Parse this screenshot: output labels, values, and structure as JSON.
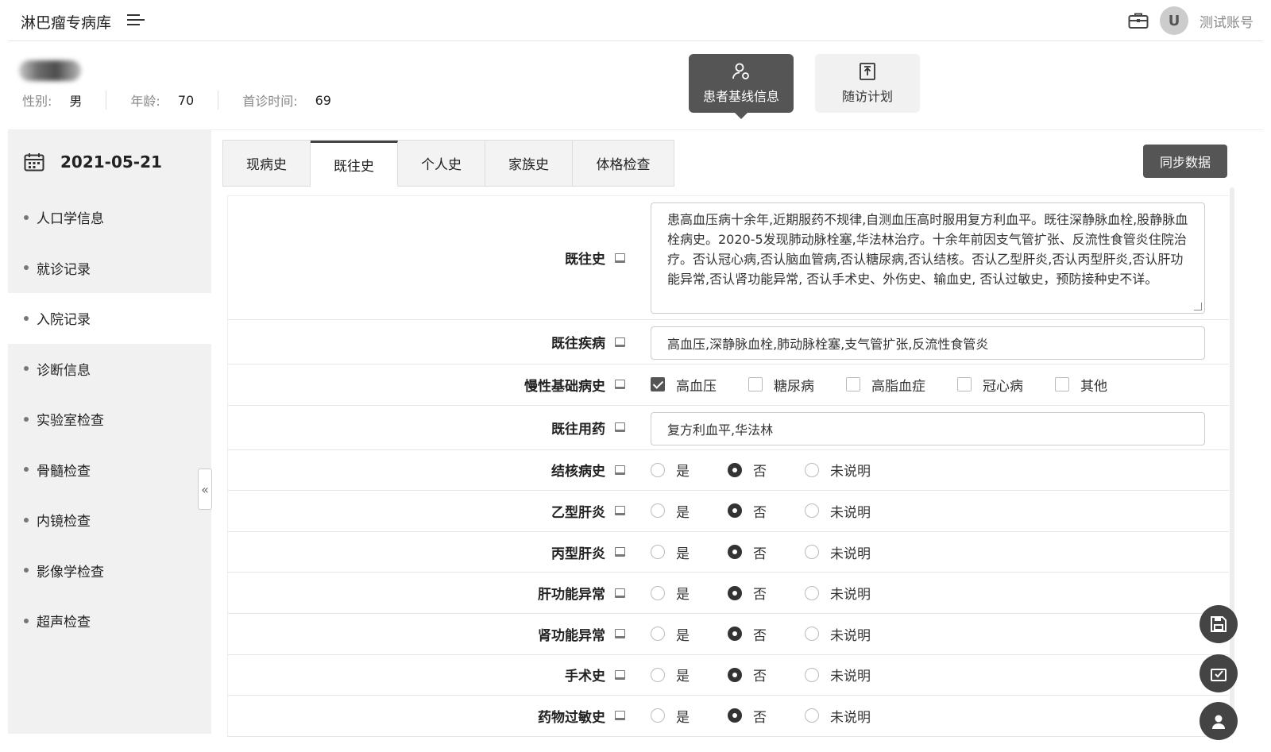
{
  "app": {
    "title": "淋巴瘤专病库",
    "account_avatar_letter": "U",
    "account_name": "测试账号"
  },
  "patient": {
    "gender_label": "性别:",
    "gender_value": "男",
    "age_label": "年龄:",
    "age_value": "70",
    "first_visit_label": "首诊时间:",
    "first_visit_value": "69"
  },
  "nav": {
    "baseline": "患者基线信息",
    "followup": "随访计划"
  },
  "sidebar": {
    "date": "2021-05-21",
    "items": [
      {
        "label": "人口学信息"
      },
      {
        "label": "就诊记录"
      },
      {
        "label": "入院记录"
      },
      {
        "label": "诊断信息"
      },
      {
        "label": "实验室检查"
      },
      {
        "label": "骨髓检查"
      },
      {
        "label": "内镜检查"
      },
      {
        "label": "影像学检查"
      },
      {
        "label": "超声检查"
      }
    ],
    "active_index": 2
  },
  "tabs": [
    {
      "label": "现病史"
    },
    {
      "label": "既往史"
    },
    {
      "label": "个人史"
    },
    {
      "label": "家族史"
    },
    {
      "label": "体格检查"
    }
  ],
  "sync_label": "同步数据",
  "form": {
    "past_history": {
      "label": "既往史",
      "value": "患高血压病十余年,近期服药不规律,自测血压高时服用复方利血平。既往深静脉血栓,股静脉血栓病史。2020-5发现肺动脉栓塞,华法林治疗。十余年前因支气管扩张、反流性食管炎住院治疗。否认冠心病,否认脑血管病,否认糖尿病,否认结核。否认乙型肝炎,否认丙型肝炎,否认肝功能异常,否认肾功能异常, 否认手术史、外伤史、输血史, 否认过敏史，预防接种史不详。"
    },
    "past_disease": {
      "label": "既往疾病",
      "value": "高血压,深静脉血栓,肺动脉栓塞,支气管扩张,反流性食管炎"
    },
    "chronic": {
      "label": "慢性基础病史",
      "options": [
        "高血压",
        "糖尿病",
        "高脂血症",
        "冠心病",
        "其他"
      ],
      "checked": [
        true,
        false,
        false,
        false,
        false
      ]
    },
    "past_meds": {
      "label": "既往用药",
      "value": "复方利血平,华法林"
    },
    "radio_options": [
      "是",
      "否",
      "未说明"
    ],
    "radio_rows": [
      {
        "label": "结核病史",
        "selected": 1
      },
      {
        "label": "乙型肝炎",
        "selected": 1
      },
      {
        "label": "丙型肝炎",
        "selected": 1
      },
      {
        "label": "肝功能异常",
        "selected": 1
      },
      {
        "label": "肾功能异常",
        "selected": 1
      },
      {
        "label": "手术史",
        "selected": 1
      },
      {
        "label": "药物过敏史",
        "selected": 1
      }
    ]
  },
  "colors": {
    "accent_dark": "#555555",
    "sidebar_bg": "#f1f1f1"
  }
}
